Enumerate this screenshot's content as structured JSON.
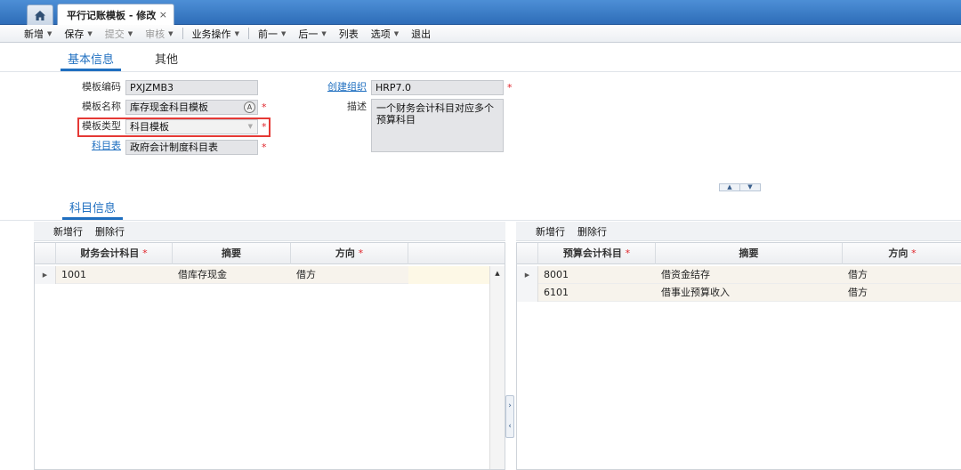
{
  "tabs": {
    "home_icon": "home-icon",
    "active_tab_title": "平行记账模板 - 修改",
    "close_glyph": "×"
  },
  "toolbar": {
    "items": [
      {
        "label": "新增",
        "dropdown": true,
        "enabled": true
      },
      {
        "label": "保存",
        "dropdown": true,
        "enabled": true
      },
      {
        "label": "提交",
        "dropdown": true,
        "enabled": false
      },
      {
        "label": "审核",
        "dropdown": true,
        "enabled": false
      },
      {
        "label": "业务操作",
        "dropdown": true,
        "enabled": true
      },
      {
        "label": "前一",
        "dropdown": true,
        "enabled": true
      },
      {
        "label": "后一",
        "dropdown": true,
        "enabled": true
      },
      {
        "label": "列表",
        "dropdown": false,
        "enabled": true
      },
      {
        "label": "选项",
        "dropdown": true,
        "enabled": true
      },
      {
        "label": "退出",
        "dropdown": false,
        "enabled": true
      }
    ]
  },
  "section_tabs": {
    "basic": "基本信息",
    "other": "其他"
  },
  "form": {
    "template_code_label": "模板编码",
    "template_code_value": "PXJZMB3",
    "template_name_label": "模板名称",
    "template_name_value": "库存现金科目模板",
    "template_type_label": "模板类型",
    "template_type_value": "科目模板",
    "account_table_label": "科目表",
    "account_table_value": "政府会计制度科目表",
    "created_org_label": "创建组织",
    "created_org_value": "HRP7.0",
    "description_label": "描述",
    "description_value": "一个财务会计科目对应多个预算科目",
    "required_mark": "*"
  },
  "account_section": {
    "title": "科目信息"
  },
  "left_grid": {
    "add_row": "新增行",
    "delete_row": "删除行",
    "columns": [
      "财务会计科目",
      "摘要",
      "方向"
    ],
    "rows": [
      {
        "code": "1001",
        "summary": "借库存现金",
        "direction": "借方"
      }
    ]
  },
  "right_grid": {
    "add_row": "新增行",
    "delete_row": "删除行",
    "columns": [
      "预算会计科目",
      "摘要",
      "方向"
    ],
    "rows": [
      {
        "code": "8001",
        "summary": "借资金结存",
        "direction": "借方"
      },
      {
        "code": "6101",
        "summary": "借事业预算收入",
        "direction": "借方"
      }
    ]
  },
  "colors": {
    "accent": "#1f6fc0",
    "required": "#e0242b",
    "highlight_box": "#e53935"
  }
}
